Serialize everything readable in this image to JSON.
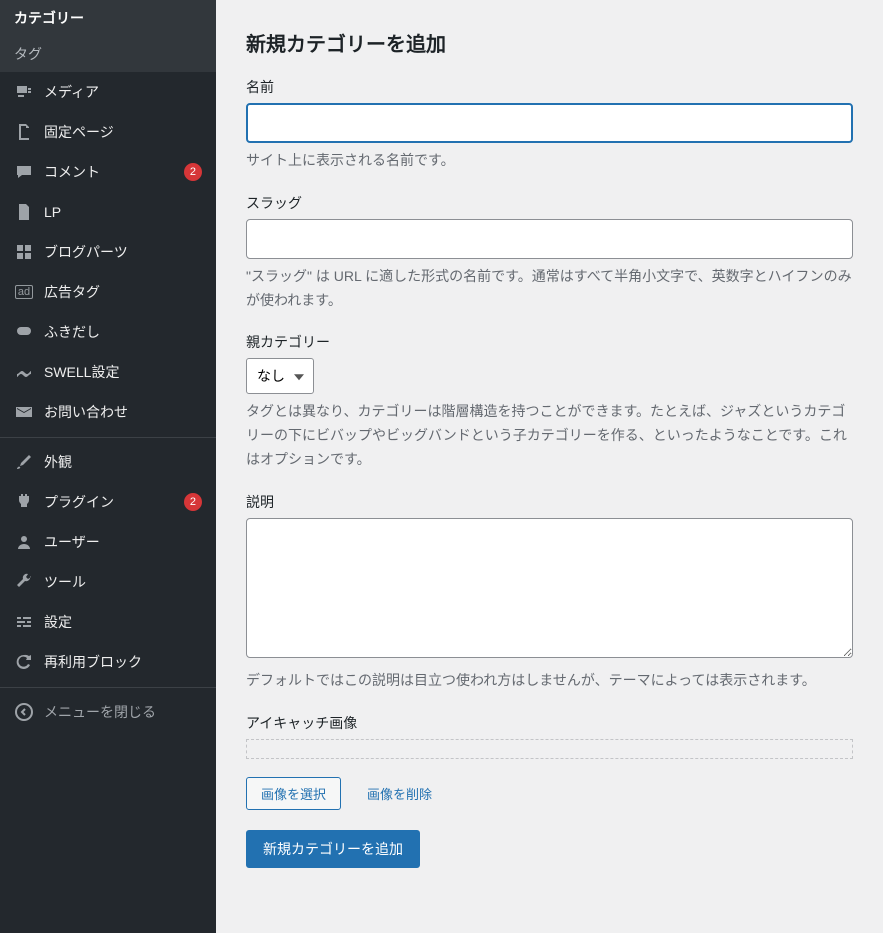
{
  "sidebar": {
    "sub_current": "カテゴリー",
    "sub_other": "タグ",
    "items": [
      {
        "label": "メディア",
        "icon": "media"
      },
      {
        "label": "固定ページ",
        "icon": "page"
      },
      {
        "label": "コメント",
        "icon": "comment",
        "badge": "2"
      },
      {
        "label": "LP",
        "icon": "file"
      },
      {
        "label": "ブログパーツ",
        "icon": "grid"
      },
      {
        "label": "広告タグ",
        "icon": "ad"
      },
      {
        "label": "ふきだし",
        "icon": "bubble"
      },
      {
        "label": "SWELL設定",
        "icon": "swell"
      },
      {
        "label": "お問い合わせ",
        "icon": "mail"
      }
    ],
    "items2": [
      {
        "label": "外観",
        "icon": "brush"
      },
      {
        "label": "プラグイン",
        "icon": "plugin",
        "badge": "2"
      },
      {
        "label": "ユーザー",
        "icon": "user"
      },
      {
        "label": "ツール",
        "icon": "tools"
      },
      {
        "label": "設定",
        "icon": "settings"
      },
      {
        "label": "再利用ブロック",
        "icon": "reuse"
      }
    ],
    "collapse": "メニューを閉じる"
  },
  "form": {
    "heading": "新規カテゴリーを追加",
    "name_label": "名前",
    "name_help": "サイト上に表示される名前です。",
    "slug_label": "スラッグ",
    "slug_help": "\"スラッグ\" は URL に適した形式の名前です。通常はすべて半角小文字で、英数字とハイフンのみが使われます。",
    "parent_label": "親カテゴリー",
    "parent_selected": "なし",
    "parent_help": "タグとは異なり、カテゴリーは階層構造を持つことができます。たとえば、ジャズというカテゴリーの下にビバップやビッグバンドという子カテゴリーを作る、といったようなことです。これはオプションです。",
    "desc_label": "説明",
    "desc_help": "デフォルトではこの説明は目立つ使われ方はしませんが、テーマによっては表示されます。",
    "thumb_label": "アイキャッチ画像",
    "select_image": "画像を選択",
    "delete_image": "画像を削除",
    "submit": "新規カテゴリーを追加"
  }
}
